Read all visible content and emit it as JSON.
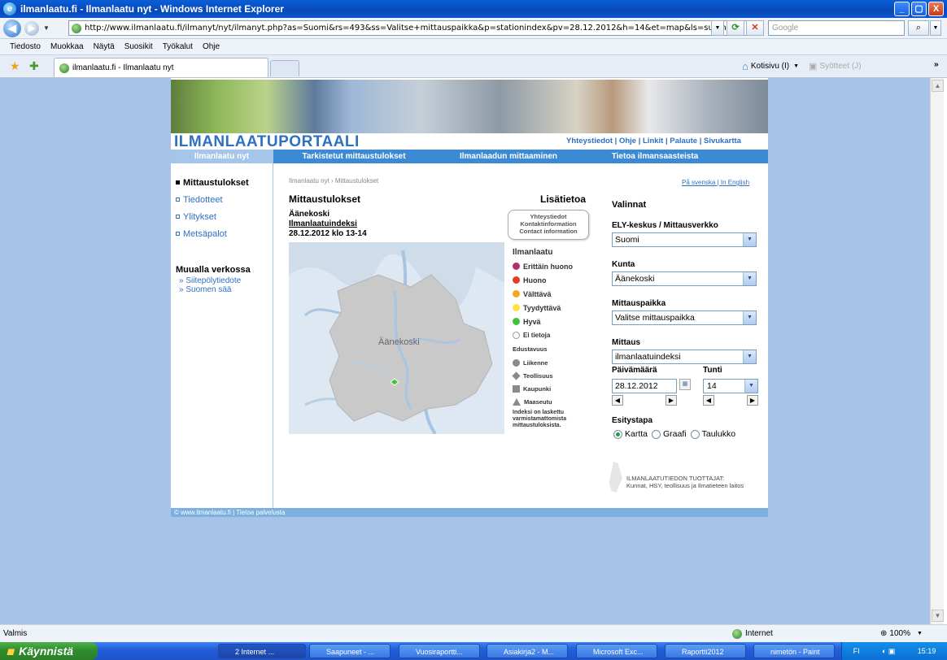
{
  "window": {
    "title": "ilmanlaatu.fi - Ilmanlaatu nyt - Windows Internet Explorer",
    "minimize": "_",
    "maximize": "▢",
    "close": "X"
  },
  "address": {
    "url": "http://www.ilmanlaatu.fi/ilmanyt/nyt/ilmanyt.php?as=Suomi&rs=493&ss=Valitse+mittauspaikka&p=stationindex&pv=28.12.2012&h=14&et=map&ls=suomi",
    "search_placeholder": "Google"
  },
  "menu": [
    "Tiedosto",
    "Muokkaa",
    "Näytä",
    "Suosikit",
    "Työkalut",
    "Ohje"
  ],
  "tab": {
    "label": "ilmanlaatu.fi - Ilmanlaatu nyt"
  },
  "toolbar": {
    "home": "Kotisivu (I)",
    "feeds": "Syötteet (J)"
  },
  "site": {
    "logo": "ILMANLAATUPORTAALI",
    "top_links": "Yhteystiedot | Ohje | Linkit | Palaute | Sivukartta",
    "nav": [
      "Ilmanlaatu nyt",
      "Tarkistetut mittaustulokset",
      "Ilmanlaadun mittaaminen",
      "Tietoa ilmansaasteista"
    ],
    "sidebar": [
      "Mittaustulokset",
      "Tiedotteet",
      "Ylitykset",
      "Metsäpalot"
    ],
    "elsewhere_title": "Muualla verkossa",
    "elsewhere_links": [
      "Siitepölytiedote",
      "Suomen sää"
    ],
    "breadcrumb": "Ilmanlaatu nyt › Mittaustulokset",
    "lang_links": "På svenska | In English",
    "heading": "Mittaustulokset",
    "more_heading": "Lisätietoa",
    "station_name": "Äänekoski",
    "index_link": "Ilmanlaatuindeksi",
    "date_time": "28.12.2012 klo 13-14",
    "contact_box": [
      "Yhteystiedot",
      "Kontaktinformation",
      "Contact information"
    ],
    "map_label": "Äänekoski",
    "legend_title": "Ilmanlaatu",
    "legend": [
      {
        "label": "Erittäin huono",
        "color": "#b0306e"
      },
      {
        "label": "Huono",
        "color": "#e53a2e"
      },
      {
        "label": "Välttävä",
        "color": "#f5a623"
      },
      {
        "label": "Tyydyttävä",
        "color": "#ffe23a"
      },
      {
        "label": "Hyvä",
        "color": "#44c23e"
      },
      {
        "label": "Ei tietoja",
        "color": "#ffffff"
      }
    ],
    "representativeness_title": "Edustavuus",
    "representativeness": [
      "Liikenne",
      "Teollisuus",
      "Kaupunki",
      "Maaseutu"
    ],
    "legend_note": "Indeksi on laskettu varmistamattomista mittaustuloksista.",
    "selections_title": "Valinnat",
    "ely_label": "ELY-keskus / Mittausverkko",
    "ely_value": "Suomi",
    "municipality_label": "Kunta",
    "municipality_value": "Äänekoski",
    "site_label": "Mittauspaikka",
    "site_value": "Valitse mittauspaikka",
    "measure_label": "Mittaus",
    "measure_value": "ilmanlaatuindeksi",
    "date_label": "Päivämäärä",
    "date_value": "28.12.2012",
    "hour_label": "Tunti",
    "hour_value": "14",
    "display_label": "Esitystapa",
    "display_options": [
      "Kartta",
      "Graafi",
      "Taulukko"
    ],
    "producers_title": "ILMANLAATUTIEDON TUOTTAJAT:",
    "producers_text": "Kunnat, HSY, teollisuus ja Ilmatieteen laitos",
    "footer": "© www.ilmanlaatu.fi | Tietoa palvelusta"
  },
  "status": {
    "text": "Valmis",
    "zone": "Internet",
    "zoom": "100%"
  },
  "taskbar": {
    "start": "Käynnistä",
    "buttons": [
      "2 Internet ...",
      "Saapuneet - ...",
      "Vuosiraportti...",
      "Asiakirja2 - M...",
      "Microsoft Exc...",
      "Raportti2012",
      "nimetön - Paint"
    ],
    "lang": "FI",
    "clock": "15:19"
  }
}
